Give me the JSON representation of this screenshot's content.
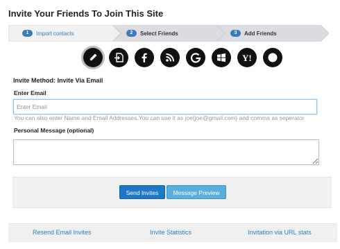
{
  "page": {
    "title": "Invite Your Friends To Join This Site"
  },
  "steps": [
    {
      "number": "1",
      "label": "Import contacts",
      "active": true
    },
    {
      "number": "2",
      "label": "Select Friends",
      "active": false
    },
    {
      "number": "3",
      "label": "Add Friends",
      "active": false
    }
  ],
  "providers": [
    {
      "icon": "pencil-icon",
      "active": true
    },
    {
      "icon": "import-file-icon",
      "active": false
    },
    {
      "icon": "facebook-icon",
      "active": false
    },
    {
      "icon": "rss-icon",
      "active": false
    },
    {
      "icon": "google-icon",
      "active": false
    },
    {
      "icon": "windows-icon",
      "active": false
    },
    {
      "icon": "yahoo-icon",
      "active": false
    },
    {
      "icon": "record-icon",
      "active": false
    }
  ],
  "form": {
    "method_label": "Invite Method: Invite Via Email",
    "email_label": "Enter Email",
    "email_placeholder": "Enter Email",
    "email_value": "",
    "hint": "You can also enter Name and Email Addresses.You can use it as joe(joe@gmail.com) and comma as seperator",
    "message_label": "Personal Message (optional)",
    "message_value": ""
  },
  "buttons": {
    "send": "Send Invites",
    "preview": "Message Preview"
  },
  "footer": {
    "resend": "Resend Email Invites",
    "stats": "Invite Statistics",
    "url_stats": "Invitation via URL stats"
  },
  "colors": {
    "accent": "#3a7bb7",
    "button_primary": "#1f77c9",
    "button_secondary": "#5aaedc",
    "link": "#2a7fc0"
  }
}
